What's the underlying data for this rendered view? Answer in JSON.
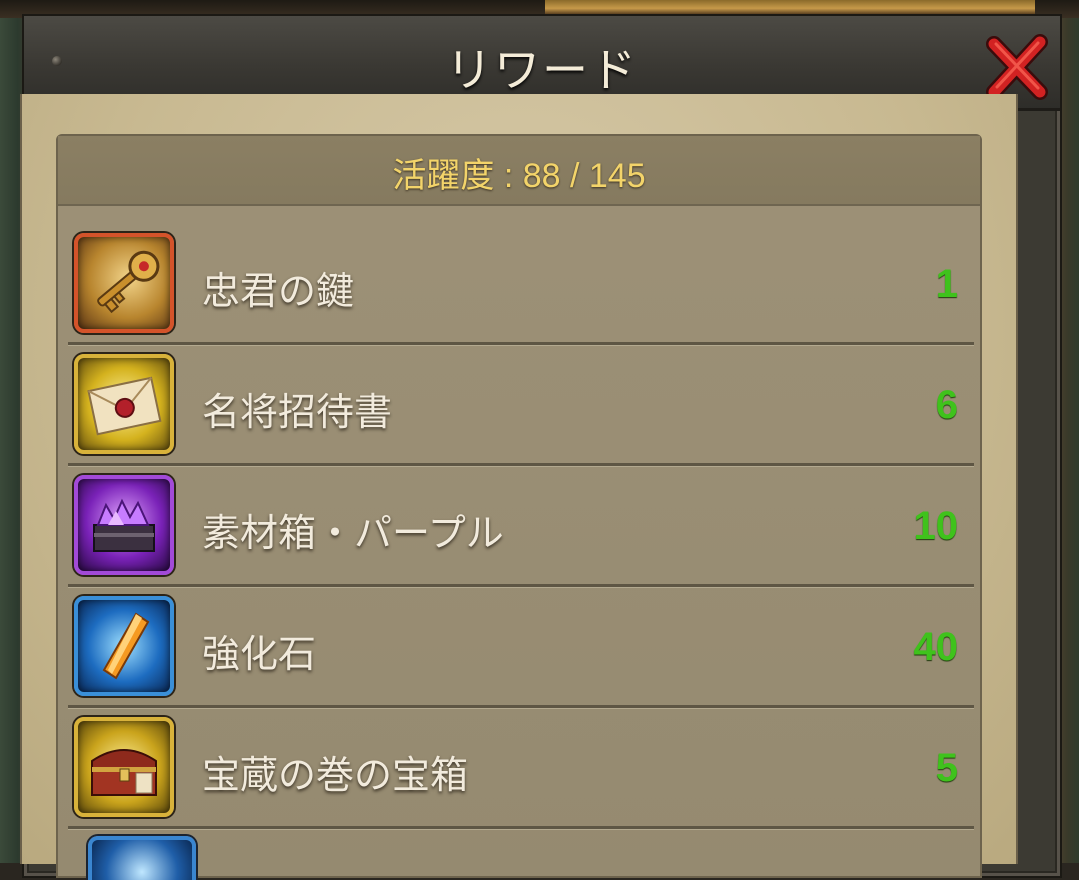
{
  "window": {
    "title": "リワード"
  },
  "activity": {
    "text": "活躍度 : 88 / 145",
    "current": 88,
    "max": 145
  },
  "rewards": [
    {
      "name": "忠君の鍵",
      "count": "1",
      "icon": "golden-key-icon",
      "frame": "#d4532a"
    },
    {
      "name": "名将招待書",
      "count": "6",
      "icon": "sealed-letter-icon",
      "frame": "#d8b23a"
    },
    {
      "name": "素材箱・パープル",
      "count": "10",
      "icon": "purple-crystal-chest-icon",
      "frame": "#a24ad8"
    },
    {
      "name": "強化石",
      "count": "40",
      "icon": "orange-crystal-icon",
      "frame": "#3a8fd8"
    },
    {
      "name": "宝蔵の巻の宝箱",
      "count": "5",
      "icon": "treasure-chest-icon",
      "frame": "#d8b23a"
    }
  ],
  "colors": {
    "count_green": "#3fc21c",
    "activity_gold": "#f3d46a",
    "close_red": "#d22222"
  }
}
